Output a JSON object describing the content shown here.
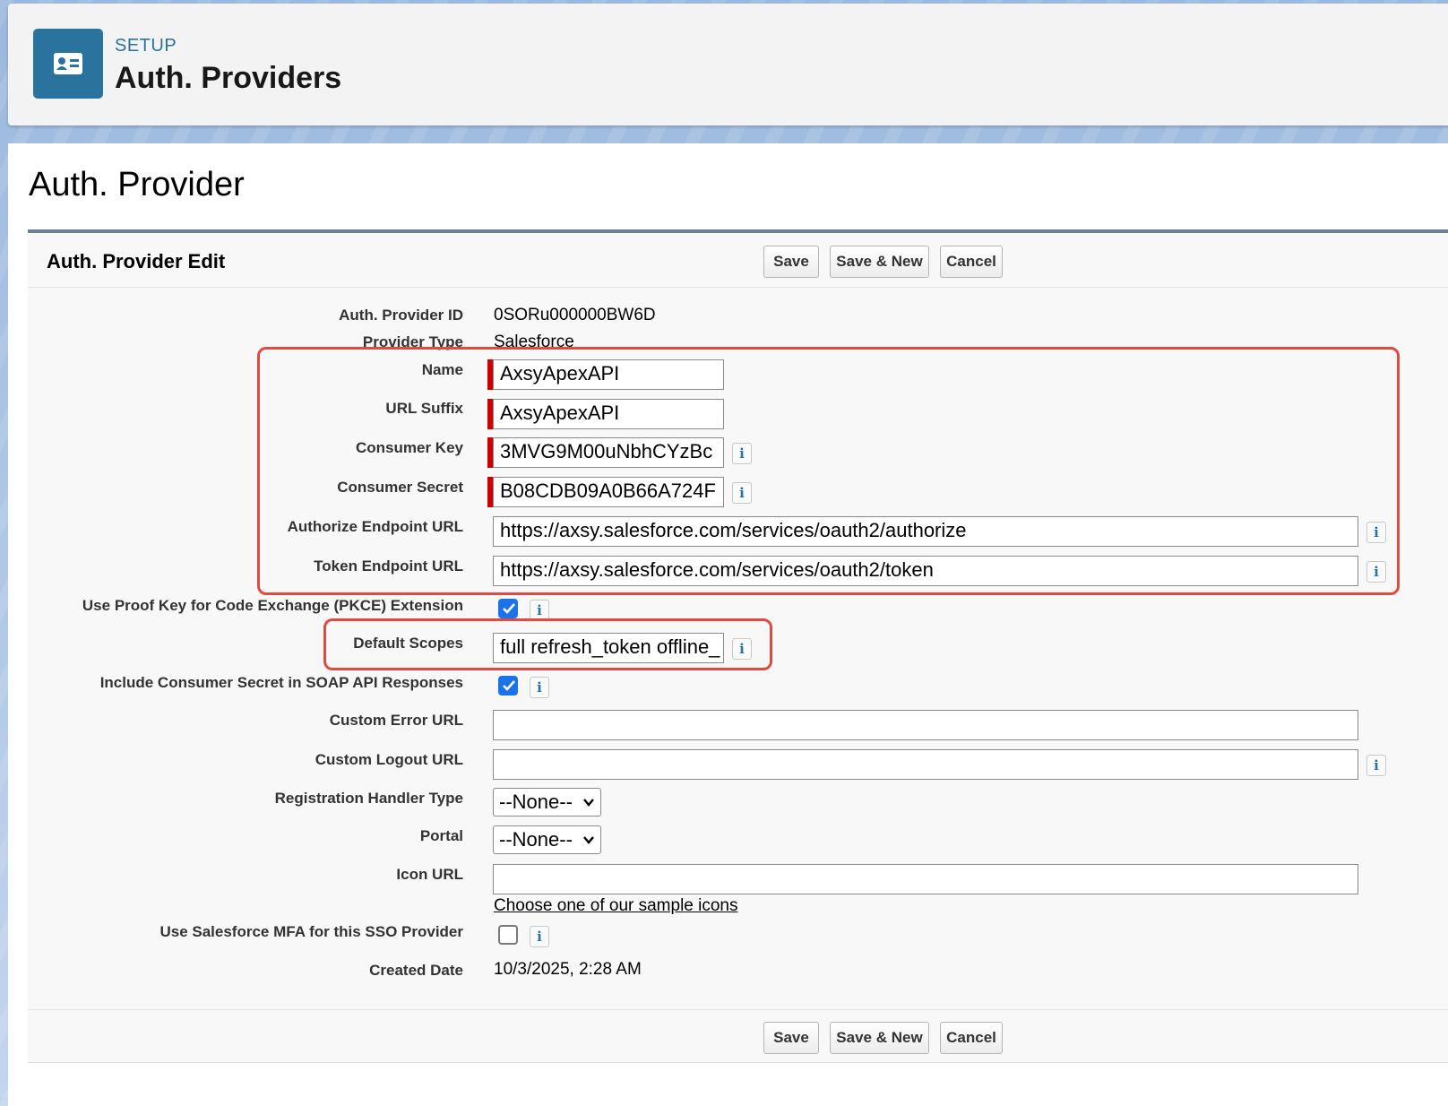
{
  "header": {
    "breadcrumb": "SETUP",
    "title": "Auth. Providers",
    "icon": "contact-card-icon"
  },
  "page": {
    "title": "Auth. Provider"
  },
  "panel": {
    "title": "Auth. Provider Edit",
    "buttons": {
      "save": "Save",
      "save_new": "Save & New",
      "cancel": "Cancel"
    }
  },
  "fields": {
    "provider_id": {
      "label": "Auth. Provider ID",
      "value": "0SORu000000BW6D"
    },
    "provider_type": {
      "label": "Provider Type",
      "value": "Salesforce"
    },
    "name": {
      "label": "Name",
      "value": "AxsyApexAPI"
    },
    "url_suffix": {
      "label": "URL Suffix",
      "value": "AxsyApexAPI"
    },
    "consumer_key": {
      "label": "Consumer Key",
      "value": "3MVG9M00uNbhCYzBc"
    },
    "consumer_secret": {
      "label": "Consumer Secret",
      "value": "B08CDB09A0B66A724F"
    },
    "authorize_url": {
      "label": "Authorize Endpoint URL",
      "value": "https://axsy.salesforce.com/services/oauth2/authorize"
    },
    "token_url": {
      "label": "Token Endpoint URL",
      "value": "https://axsy.salesforce.com/services/oauth2/token"
    },
    "pkce": {
      "label": "Use Proof Key for Code Exchange (PKCE) Extension",
      "checked": true
    },
    "default_scopes": {
      "label": "Default Scopes",
      "value": "full refresh_token offline_"
    },
    "include_secret": {
      "label": "Include Consumer Secret in SOAP API Responses",
      "checked": true
    },
    "custom_error_url": {
      "label": "Custom Error URL",
      "value": ""
    },
    "custom_logout_url": {
      "label": "Custom Logout URL",
      "value": ""
    },
    "registration_handler": {
      "label": "Registration Handler Type",
      "value": "--None--"
    },
    "portal": {
      "label": "Portal",
      "value": "--None--"
    },
    "icon_url": {
      "label": "Icon URL",
      "value": "",
      "link": "Choose one of our sample icons"
    },
    "mfa": {
      "label": "Use Salesforce MFA for this SSO Provider",
      "checked": false
    },
    "created_date": {
      "label": "Created Date",
      "value": "10/3/2025, 2:28 AM"
    }
  },
  "info_glyph": "i",
  "colors": {
    "brand_blue": "#2a739e",
    "required_red": "#c00000",
    "highlight_red": "#e04a3f",
    "checkbox_blue": "#1a73e8"
  }
}
